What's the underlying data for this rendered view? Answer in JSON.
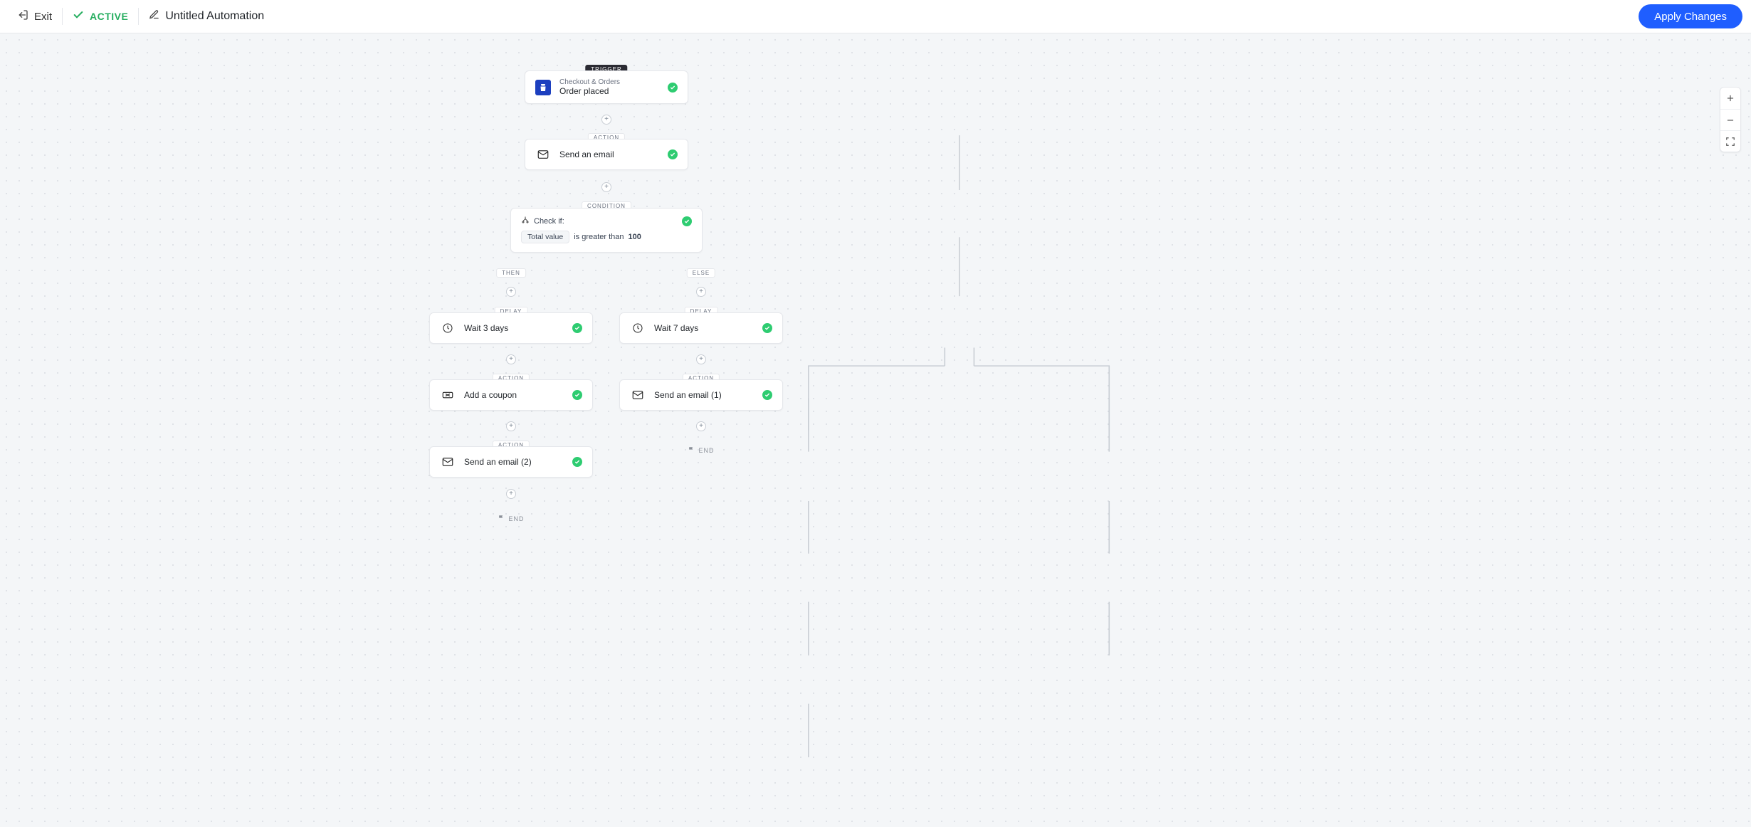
{
  "header": {
    "exit": "Exit",
    "status": "ACTIVE",
    "title": "Untitled Automation",
    "apply": "Apply Changes"
  },
  "labels": {
    "trigger": "TRIGGER",
    "action": "ACTION",
    "condition": "CONDITION",
    "delay": "DELAY",
    "then": "THEN",
    "else": "ELSE",
    "end": "END"
  },
  "trigger": {
    "app": "Checkout & Orders",
    "event": "Order placed"
  },
  "action_email_1": "Send an email",
  "condition": {
    "check_if": "Check if:",
    "field": "Total value",
    "op": "is greater than",
    "value": "100"
  },
  "then": {
    "delay": "Wait 3 days",
    "coupon": "Add a coupon",
    "email": "Send an email (2)"
  },
  "else": {
    "delay": "Wait 7 days",
    "email": "Send an email (1)"
  }
}
